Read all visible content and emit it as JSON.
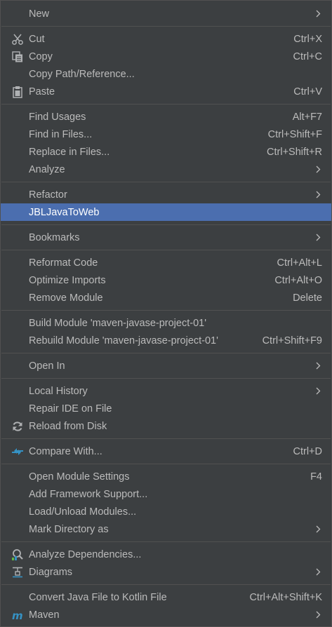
{
  "menu": {
    "new": "New",
    "cut": "Cut",
    "cut_shortcut": "Ctrl+X",
    "copy": "Copy",
    "copy_shortcut": "Ctrl+C",
    "copy_path": "Copy Path/Reference...",
    "paste": "Paste",
    "paste_shortcut": "Ctrl+V",
    "find_usages": "Find Usages",
    "find_usages_shortcut": "Alt+F7",
    "find_in_files": "Find in Files...",
    "find_in_files_shortcut": "Ctrl+Shift+F",
    "replace_in_files": "Replace in Files...",
    "replace_in_files_shortcut": "Ctrl+Shift+R",
    "analyze": "Analyze",
    "refactor": "Refactor",
    "jbl": "JBLJavaToWeb",
    "bookmarks": "Bookmarks",
    "reformat": "Reformat Code",
    "reformat_shortcut": "Ctrl+Alt+L",
    "optimize": "Optimize Imports",
    "optimize_shortcut": "Ctrl+Alt+O",
    "remove_module": "Remove Module",
    "remove_module_shortcut": "Delete",
    "build_module": "Build Module 'maven-javase-project-01'",
    "rebuild_module": "Rebuild Module 'maven-javase-project-01'",
    "rebuild_shortcut": "Ctrl+Shift+F9",
    "open_in": "Open In",
    "local_history": "Local History",
    "repair_ide": "Repair IDE on File",
    "reload_disk": "Reload from Disk",
    "compare_with": "Compare With...",
    "compare_shortcut": "Ctrl+D",
    "open_module_settings": "Open Module Settings",
    "open_module_settings_shortcut": "F4",
    "add_framework": "Add Framework Support...",
    "load_unload": "Load/Unload Modules...",
    "mark_directory": "Mark Directory as",
    "analyze_deps": "Analyze Dependencies...",
    "diagrams": "Diagrams",
    "convert_kotlin": "Convert Java File to Kotlin File",
    "convert_kotlin_shortcut": "Ctrl+Alt+Shift+K",
    "maven": "Maven"
  },
  "icons": {
    "cut": "scissors-icon",
    "copy": "copy-icon",
    "paste": "clipboard-icon",
    "reload": "reload-icon",
    "compare": "compare-arrows-icon",
    "analyze_deps": "analyze-dependencies-icon",
    "diagrams": "diagram-icon",
    "maven": "maven-icon",
    "submenu": "chevron-right-icon"
  },
  "colors": {
    "background": "#3c3f41",
    "separator": "#515151",
    "text": "#bbbbbb",
    "selection": "#4b6eaf",
    "selection_text": "#ffffff",
    "compare_icon": "#3592c4"
  }
}
